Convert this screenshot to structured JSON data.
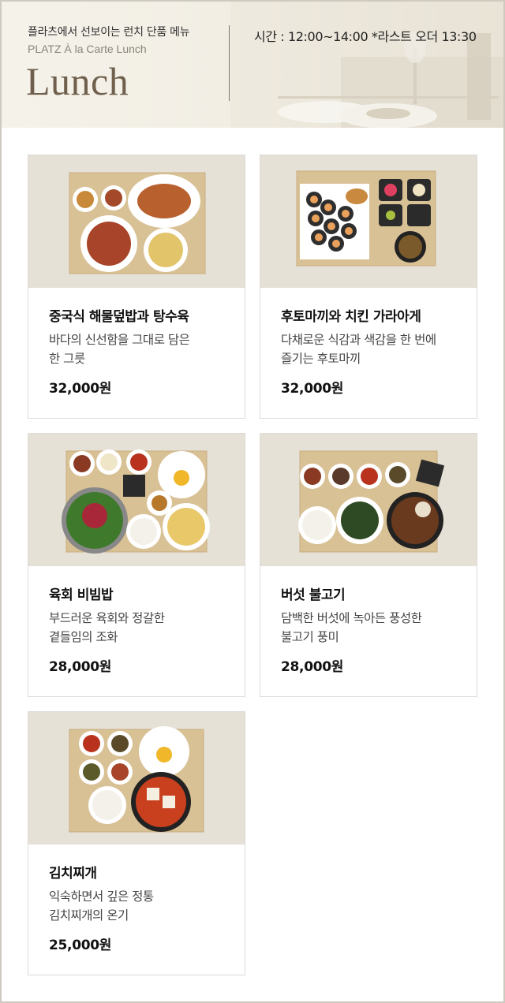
{
  "header": {
    "subtitle": "플라츠에서 선보이는 런치 단품 메뉴",
    "subtitle_en": "PLATZ À la Carte Lunch",
    "title": "Lunch",
    "hours": "시간 : 12:00~14:00 *라스트 오더 13:30"
  },
  "menu": [
    {
      "name": "중국식 해물덮밥과 탕수육",
      "desc_line1": "바다의 신선함을 그대로 담은",
      "desc_line2": "한 그릇",
      "price": "32,000원"
    },
    {
      "name": "후토마끼와 치킨 가라아게",
      "desc_line1": "다채로운 식감과 색감을 한 번에",
      "desc_line2": "즐기는 후토마끼",
      "price": "32,000원"
    },
    {
      "name": "육회 비빔밥",
      "desc_line1": "부드러운 육회와 정갈한",
      "desc_line2": "곁들임의 조화",
      "price": "28,000원"
    },
    {
      "name": "버섯 불고기",
      "desc_line1": "담백한 버섯에 녹아든 풍성한",
      "desc_line2": "불고기 풍미",
      "price": "28,000원"
    },
    {
      "name": "김치찌개",
      "desc_line1": "익숙하면서 깊은 정통",
      "desc_line2": "김치찌개의 온기",
      "price": "25,000원"
    }
  ],
  "colors": {
    "title": "#6f5f4c",
    "border": "#dedbd6",
    "photo_bg": "#e8e3d9",
    "tray": "#dcc49a"
  }
}
